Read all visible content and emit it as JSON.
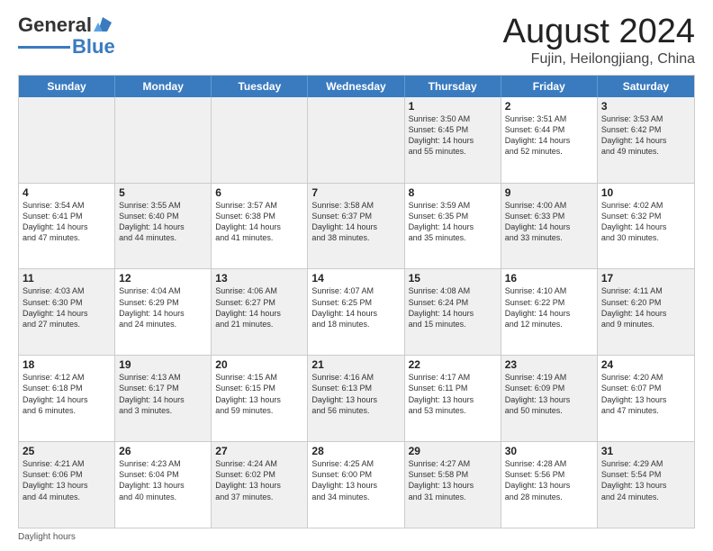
{
  "header": {
    "logo_general": "General",
    "logo_blue": "Blue",
    "title": "August 2024",
    "subtitle": "Fujin, Heilongjiang, China"
  },
  "weekdays": [
    "Sunday",
    "Monday",
    "Tuesday",
    "Wednesday",
    "Thursday",
    "Friday",
    "Saturday"
  ],
  "weeks": [
    [
      {
        "day": "",
        "info": "",
        "empty": true
      },
      {
        "day": "",
        "info": "",
        "empty": true
      },
      {
        "day": "",
        "info": "",
        "empty": true
      },
      {
        "day": "",
        "info": "",
        "empty": true
      },
      {
        "day": "1",
        "info": "Sunrise: 3:50 AM\nSunset: 6:45 PM\nDaylight: 14 hours\nand 55 minutes."
      },
      {
        "day": "2",
        "info": "Sunrise: 3:51 AM\nSunset: 6:44 PM\nDaylight: 14 hours\nand 52 minutes."
      },
      {
        "day": "3",
        "info": "Sunrise: 3:53 AM\nSunset: 6:42 PM\nDaylight: 14 hours\nand 49 minutes."
      }
    ],
    [
      {
        "day": "4",
        "info": "Sunrise: 3:54 AM\nSunset: 6:41 PM\nDaylight: 14 hours\nand 47 minutes."
      },
      {
        "day": "5",
        "info": "Sunrise: 3:55 AM\nSunset: 6:40 PM\nDaylight: 14 hours\nand 44 minutes."
      },
      {
        "day": "6",
        "info": "Sunrise: 3:57 AM\nSunset: 6:38 PM\nDaylight: 14 hours\nand 41 minutes."
      },
      {
        "day": "7",
        "info": "Sunrise: 3:58 AM\nSunset: 6:37 PM\nDaylight: 14 hours\nand 38 minutes."
      },
      {
        "day": "8",
        "info": "Sunrise: 3:59 AM\nSunset: 6:35 PM\nDaylight: 14 hours\nand 35 minutes."
      },
      {
        "day": "9",
        "info": "Sunrise: 4:00 AM\nSunset: 6:33 PM\nDaylight: 14 hours\nand 33 minutes."
      },
      {
        "day": "10",
        "info": "Sunrise: 4:02 AM\nSunset: 6:32 PM\nDaylight: 14 hours\nand 30 minutes."
      }
    ],
    [
      {
        "day": "11",
        "info": "Sunrise: 4:03 AM\nSunset: 6:30 PM\nDaylight: 14 hours\nand 27 minutes."
      },
      {
        "day": "12",
        "info": "Sunrise: 4:04 AM\nSunset: 6:29 PM\nDaylight: 14 hours\nand 24 minutes."
      },
      {
        "day": "13",
        "info": "Sunrise: 4:06 AM\nSunset: 6:27 PM\nDaylight: 14 hours\nand 21 minutes."
      },
      {
        "day": "14",
        "info": "Sunrise: 4:07 AM\nSunset: 6:25 PM\nDaylight: 14 hours\nand 18 minutes."
      },
      {
        "day": "15",
        "info": "Sunrise: 4:08 AM\nSunset: 6:24 PM\nDaylight: 14 hours\nand 15 minutes."
      },
      {
        "day": "16",
        "info": "Sunrise: 4:10 AM\nSunset: 6:22 PM\nDaylight: 14 hours\nand 12 minutes."
      },
      {
        "day": "17",
        "info": "Sunrise: 4:11 AM\nSunset: 6:20 PM\nDaylight: 14 hours\nand 9 minutes."
      }
    ],
    [
      {
        "day": "18",
        "info": "Sunrise: 4:12 AM\nSunset: 6:18 PM\nDaylight: 14 hours\nand 6 minutes."
      },
      {
        "day": "19",
        "info": "Sunrise: 4:13 AM\nSunset: 6:17 PM\nDaylight: 14 hours\nand 3 minutes."
      },
      {
        "day": "20",
        "info": "Sunrise: 4:15 AM\nSunset: 6:15 PM\nDaylight: 13 hours\nand 59 minutes."
      },
      {
        "day": "21",
        "info": "Sunrise: 4:16 AM\nSunset: 6:13 PM\nDaylight: 13 hours\nand 56 minutes."
      },
      {
        "day": "22",
        "info": "Sunrise: 4:17 AM\nSunset: 6:11 PM\nDaylight: 13 hours\nand 53 minutes."
      },
      {
        "day": "23",
        "info": "Sunrise: 4:19 AM\nSunset: 6:09 PM\nDaylight: 13 hours\nand 50 minutes."
      },
      {
        "day": "24",
        "info": "Sunrise: 4:20 AM\nSunset: 6:07 PM\nDaylight: 13 hours\nand 47 minutes."
      }
    ],
    [
      {
        "day": "25",
        "info": "Sunrise: 4:21 AM\nSunset: 6:06 PM\nDaylight: 13 hours\nand 44 minutes."
      },
      {
        "day": "26",
        "info": "Sunrise: 4:23 AM\nSunset: 6:04 PM\nDaylight: 13 hours\nand 40 minutes."
      },
      {
        "day": "27",
        "info": "Sunrise: 4:24 AM\nSunset: 6:02 PM\nDaylight: 13 hours\nand 37 minutes."
      },
      {
        "day": "28",
        "info": "Sunrise: 4:25 AM\nSunset: 6:00 PM\nDaylight: 13 hours\nand 34 minutes."
      },
      {
        "day": "29",
        "info": "Sunrise: 4:27 AM\nSunset: 5:58 PM\nDaylight: 13 hours\nand 31 minutes."
      },
      {
        "day": "30",
        "info": "Sunrise: 4:28 AM\nSunset: 5:56 PM\nDaylight: 13 hours\nand 28 minutes."
      },
      {
        "day": "31",
        "info": "Sunrise: 4:29 AM\nSunset: 5:54 PM\nDaylight: 13 hours\nand 24 minutes."
      }
    ]
  ],
  "footer": {
    "daylight_label": "Daylight hours"
  }
}
